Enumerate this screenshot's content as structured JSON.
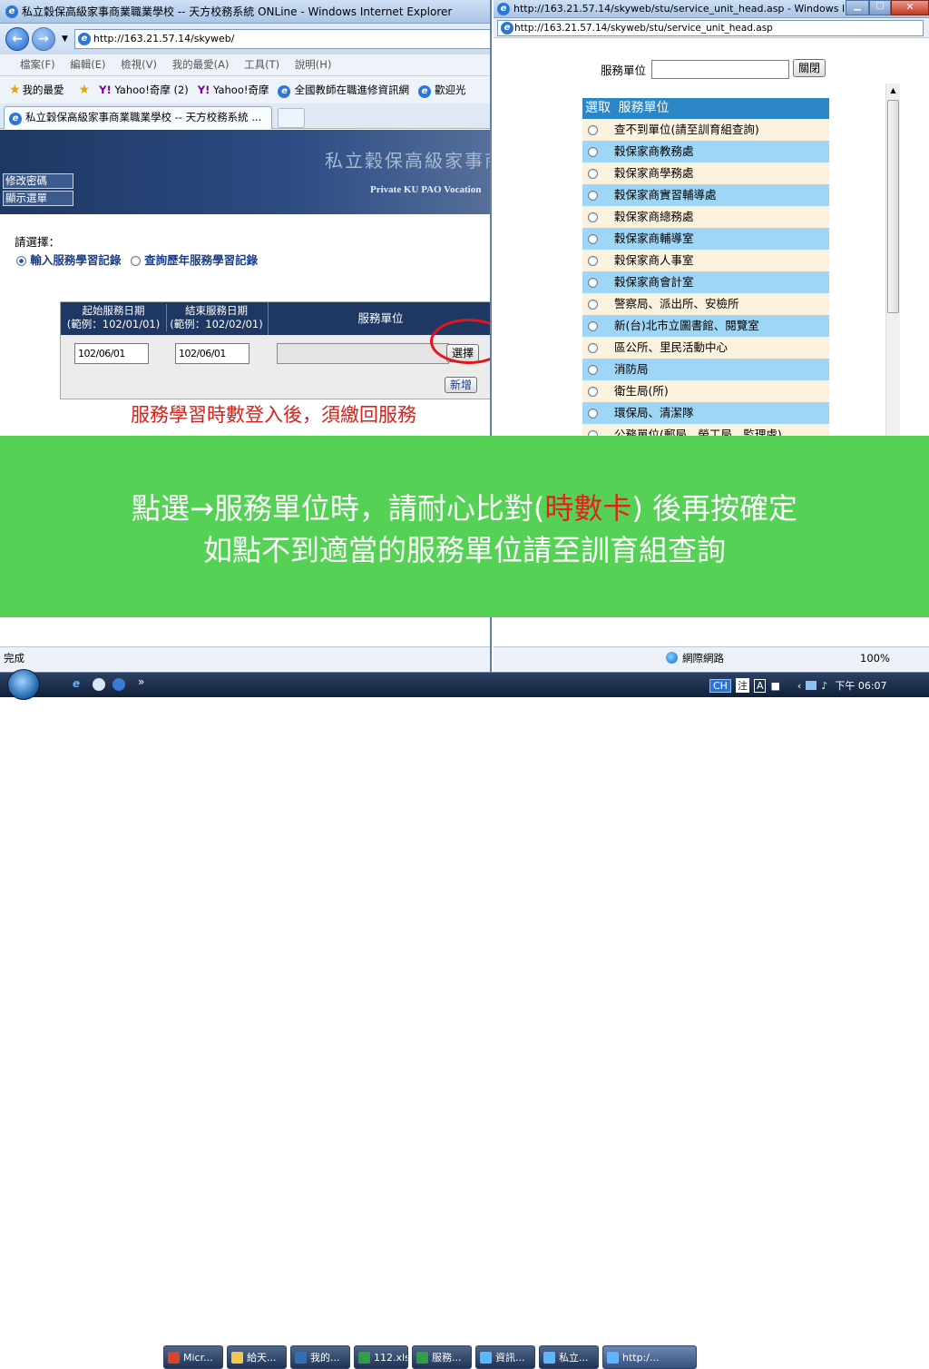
{
  "left_window": {
    "title": "私立穀保高級家事商業職業學校 -- 天方校務系統 ONLine - Windows Internet Explorer",
    "address": "http://163.21.57.14/skyweb/",
    "menu": [
      "檔案(F)",
      "編輯(E)",
      "檢視(V)",
      "我的最愛(A)",
      "工具(T)",
      "說明(H)"
    ],
    "favorites": [
      "我的最愛",
      "Yahoo!奇摩 (2)",
      "Yahoo!奇摩",
      "全國教師在職進修資訊網",
      "歡迎光"
    ],
    "tab_label": "私立穀保高級家事商業職業學校 -- 天方校務系統 ...",
    "banner_title": "私立穀保高級家事商",
    "banner_subtitle": "Private KU PAO Vocation",
    "side_buttons": [
      "修改密碼",
      "顯示選單"
    ],
    "choose_label": "請選擇：",
    "options": [
      "輸入服務學習記錄",
      "查詢歷年服務學習記錄"
    ],
    "table": {
      "start_header_1": "起始服務日期",
      "start_header_2": "(範例：102/01/01)",
      "end_header_1": "結束服務日期",
      "end_header_2": "(範例：102/02/01)",
      "unit_header": "服務單位",
      "start_value": "102/06/01",
      "end_value": "102/06/01",
      "select_button": "選擇",
      "add_button": "新增"
    },
    "warning": "服務學習時數登入後，須繳回服務",
    "status": "完成"
  },
  "right_window": {
    "title": "http://163.21.57.14/skyweb/stu/service_unit_head.asp - Windows Internet E...",
    "address": "http://163.21.57.14/skyweb/stu/service_unit_head.asp",
    "search_label": "服務單位",
    "search_value": "",
    "close_button": "關閉",
    "list_header_select": "選取",
    "list_header_unit": "服務單位",
    "units": [
      "查不到單位(請至訓育組查詢)",
      "穀保家商教務處",
      "穀保家商學務處",
      "穀保家商實習輔導處",
      "穀保家商總務處",
      "穀保家商輔導室",
      "穀保家商人事室",
      "穀保家商會計室",
      "警察局、派出所、安檢所",
      "新(台)北市立圖書館、閱覽室",
      "區公所、里民活動中心",
      "消防局",
      "衛生局(所)",
      "環保局、清潔隊",
      "公務單位(郵局、榮工局、監理處)"
    ],
    "zone": "網際網路",
    "zoom": "100%"
  },
  "overlay": {
    "line1_before": "點選→服務單位時，請耐心比對(",
    "line1_highlight": "時數卡",
    "line1_after": ") 後再按確定",
    "line2": "如點不到適當的服務單位請至訓育組查詢"
  },
  "taskbar": {
    "items": [
      "Micr...",
      "給天...",
      "我的...",
      "112.xls",
      "服務...",
      "資訊...",
      "私立...",
      "http:/..."
    ],
    "lang": "CH",
    "clock": "下午 06:07"
  },
  "colors": {
    "overlay_bg": "#55d155",
    "highlight": "#e0241b",
    "list_blue": "#a0d6f5",
    "list_cream": "#fcf1dd",
    "header_navy": "#1f3763"
  }
}
